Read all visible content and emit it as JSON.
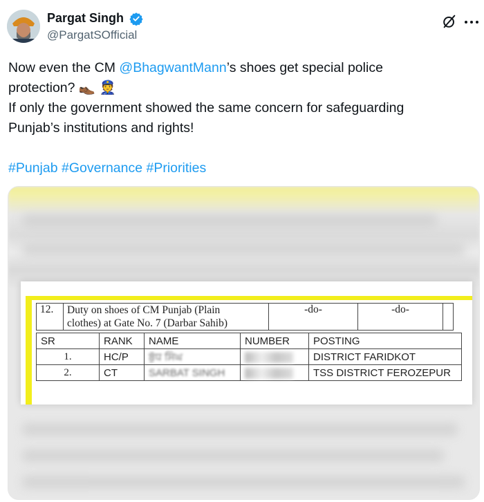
{
  "post": {
    "author_name": "Pargat Singh",
    "author_handle": "@PargatSOfficial",
    "text_line1_pre": "Now even the CM ",
    "mention": "@BhagwantMann",
    "text_line1_post": "’s shoes get special police",
    "text_line2": "protection? 👞 👮",
    "text_line3": "If only the government showed the same concern for safeguarding",
    "text_line4": "Punjab’s institutions and rights!",
    "hashtags": [
      "#Punjab",
      "#Governance",
      "#Priorities"
    ]
  },
  "icons": {
    "verified": "verified-badge-icon",
    "grok": "grok-icon",
    "more": "more-options-icon"
  },
  "colors": {
    "link": "#1d9bf0",
    "verified": "#1d9bf0",
    "highlight": "#f2ee1c"
  },
  "document": {
    "duty_row": {
      "sr": "12.",
      "description_line1": "Duty on shoes of CM Punjab (Plain",
      "description_line2": "clothes) at Gate No. 7 (Darbar Sahib)",
      "col3": "-do-",
      "col4": "-do-"
    },
    "columns": [
      "SR",
      "RANK",
      "NAME",
      "NUMBER",
      "POSTING"
    ],
    "rows": [
      {
        "sr": "1.",
        "rank": "HC/P",
        "name": "ਬੁੱਧ ਸਿੰਘ",
        "posting": "DISTRICT FARIDKOT"
      },
      {
        "sr": "2.",
        "rank": "CT",
        "name": "SARBAT SINGH",
        "posting": "TSS DISTRICT FEROZEPUR"
      }
    ]
  }
}
